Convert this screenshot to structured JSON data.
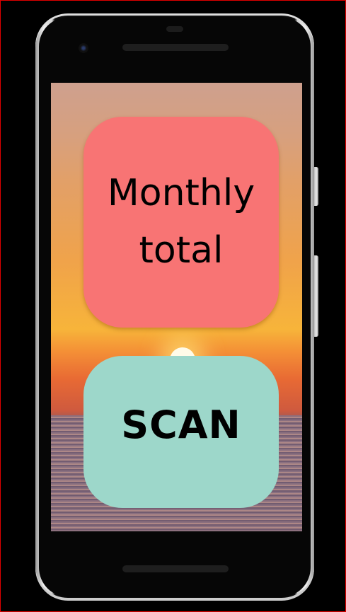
{
  "buttons": {
    "monthly_total": {
      "label_line1": "Monthly",
      "label_line2": "total",
      "color": "#f87474"
    },
    "scan": {
      "label": "SCAN",
      "color": "#9dd7ca"
    }
  }
}
